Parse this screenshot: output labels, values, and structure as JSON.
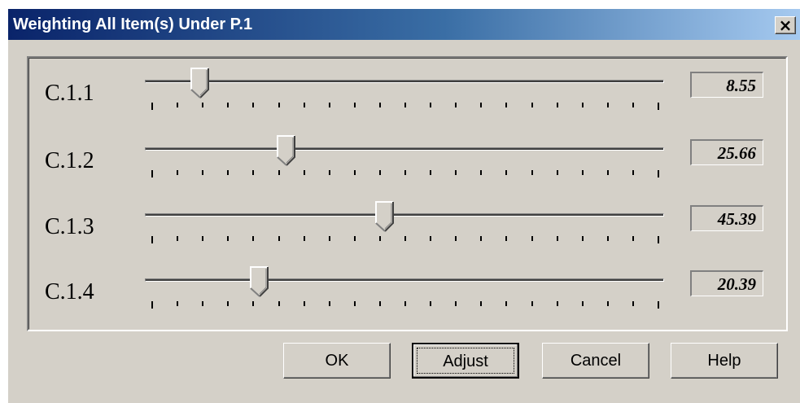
{
  "window": {
    "title": "Weighting All Item(s) Under P.1",
    "close_glyph": "×"
  },
  "sliders": [
    {
      "label": "C.1.1",
      "value": "8.55",
      "fraction": 0.0855
    },
    {
      "label": "C.1.2",
      "value": "25.66",
      "fraction": 0.2566
    },
    {
      "label": "C.1.3",
      "value": "45.39",
      "fraction": 0.4539
    },
    {
      "label": "C.1.4",
      "value": "20.39",
      "fraction": 0.2039
    }
  ],
  "buttons": {
    "ok": "OK",
    "adjust": "Adjust",
    "cancel": "Cancel",
    "help": "Help"
  },
  "tick_count": 21,
  "icons": [
    "close-icon",
    "slider-thumb-icon"
  ],
  "colors": {
    "face": "#d4d0c8",
    "title_start": "#0a246a",
    "title_end": "#a6caf0"
  }
}
